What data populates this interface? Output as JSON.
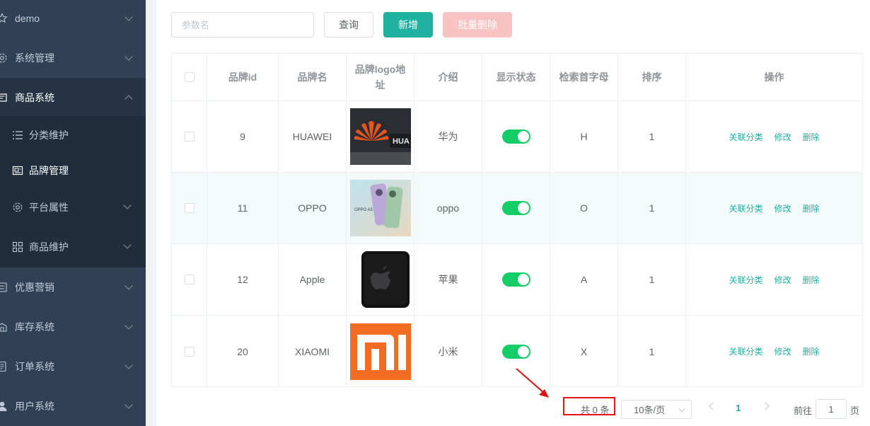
{
  "sidebar": {
    "items": [
      {
        "label": "demo",
        "icon": "star-icon",
        "open": false
      },
      {
        "label": "系统管理",
        "icon": "gear-icon",
        "open": false
      },
      {
        "label": "商品系统",
        "icon": "product-icon",
        "open": true
      },
      {
        "label": "优惠营销",
        "icon": "coupon-icon",
        "open": false
      },
      {
        "label": "库存系统",
        "icon": "warehouse-icon",
        "open": false
      },
      {
        "label": "订单系统",
        "icon": "order-icon",
        "open": false
      },
      {
        "label": "用户系统",
        "icon": "user-icon",
        "open": false
      }
    ],
    "subitems": [
      {
        "label": "分类维护",
        "icon": "list-icon"
      },
      {
        "label": "品牌管理",
        "icon": "brand-icon",
        "active": true
      },
      {
        "label": "平台属性",
        "icon": "gear-icon",
        "expandable": true
      },
      {
        "label": "商品维护",
        "icon": "grid-icon",
        "expandable": true
      }
    ]
  },
  "toolbar": {
    "search_placeholder": "参数名",
    "query_label": "查询",
    "add_label": "新增",
    "batch_delete_label": "批量删除"
  },
  "table": {
    "headers": [
      "品牌id",
      "品牌名",
      "品牌logo地址",
      "介绍",
      "显示状态",
      "检索首字母",
      "排序",
      "操作"
    ],
    "header_logo_line1": "品牌logo地",
    "header_logo_line2": "址",
    "rows": [
      {
        "id": "9",
        "name": "HUAWEI",
        "logo": "huawei-logo",
        "desc": "华为",
        "show": true,
        "letter": "H",
        "sort": "1"
      },
      {
        "id": "11",
        "name": "OPPO",
        "logo": "oppo-logo",
        "desc": "oppo",
        "show": true,
        "letter": "O",
        "sort": "1"
      },
      {
        "id": "12",
        "name": "Apple",
        "logo": "apple-logo",
        "desc": "苹果",
        "show": true,
        "letter": "A",
        "sort": "1"
      },
      {
        "id": "20",
        "name": "XIAOMI",
        "logo": "xiaomi-logo",
        "desc": "小米",
        "show": true,
        "letter": "X",
        "sort": "1"
      }
    ],
    "ops": {
      "link_category": "关联分类",
      "edit": "修改",
      "delete": "删除"
    }
  },
  "pagination": {
    "total_text": "共 0 条",
    "page_size_text": "10条/页",
    "current_page": "1",
    "goto_prefix": "前往",
    "goto_value": "1",
    "goto_suffix": "页"
  },
  "colors": {
    "accent": "#20b2a0",
    "sidebar_bg": "#304156",
    "submenu_bg": "#1f2d3d",
    "switch_on": "#13ce66",
    "danger_light": "#f9c3c3",
    "annotation_red": "#e11111"
  }
}
